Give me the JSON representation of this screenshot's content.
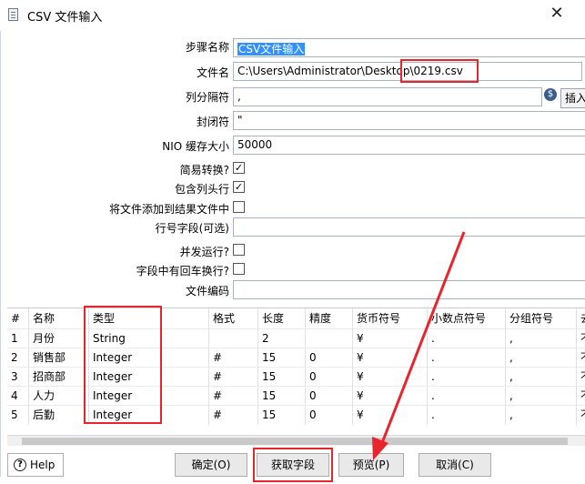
{
  "window": {
    "title": "CSV 文件输入",
    "close": "✕"
  },
  "form": {
    "step_name_label": "步骤名称",
    "step_name_value": "CSV文件输入",
    "filename_label": "文件名",
    "filename_value": "C:\\Users\\Administrator\\Desktop\\0219.csv",
    "delimiter_label": "列分隔符",
    "delimiter_value": ",",
    "var_icon": "$",
    "insert_label": "插入",
    "enclosure_label": "封闭符",
    "enclosure_value": "\"",
    "nio_label": "NIO 缓存大小",
    "nio_value": "50000",
    "lazy_label": "简易转换?",
    "lazy_checked": "✓",
    "header_label": "包含列头行",
    "header_checked": "✓",
    "add_result_label": "将文件添加到结果文件中",
    "rownum_label": "行号字段(可选)",
    "parallel_label": "并发运行?",
    "newline_label": "字段中有回车换行?",
    "encoding_label": "文件编码"
  },
  "table": {
    "columns": [
      "#",
      "名称",
      "类型",
      "格式",
      "长度",
      "精度",
      "货币符号",
      "小数点符号",
      "分组符号",
      "去"
    ],
    "rows": [
      [
        "1",
        "月份",
        "String",
        "",
        "2",
        "",
        "¥",
        ".",
        ",",
        "不"
      ],
      [
        "2",
        "销售部",
        "Integer",
        "#",
        "15",
        "0",
        "¥",
        ".",
        ",",
        "不"
      ],
      [
        "3",
        "招商部",
        "Integer",
        "#",
        "15",
        "0",
        "¥",
        ".",
        ",",
        "不"
      ],
      [
        "4",
        "人力",
        "Integer",
        "#",
        "15",
        "0",
        "¥",
        ".",
        ",",
        "不"
      ],
      [
        "5",
        "后勤",
        "Integer",
        "#",
        "15",
        "0",
        "¥",
        ".",
        ",",
        "不"
      ]
    ]
  },
  "buttons": {
    "help": "Help",
    "help_icon": "?",
    "ok": "确定(O)",
    "get_fields": "获取字段",
    "preview": "预览(P)",
    "cancel": "取消(C)"
  },
  "colors": {
    "annotation_red": "#e8242c",
    "selection_blue": "#3390ff"
  }
}
